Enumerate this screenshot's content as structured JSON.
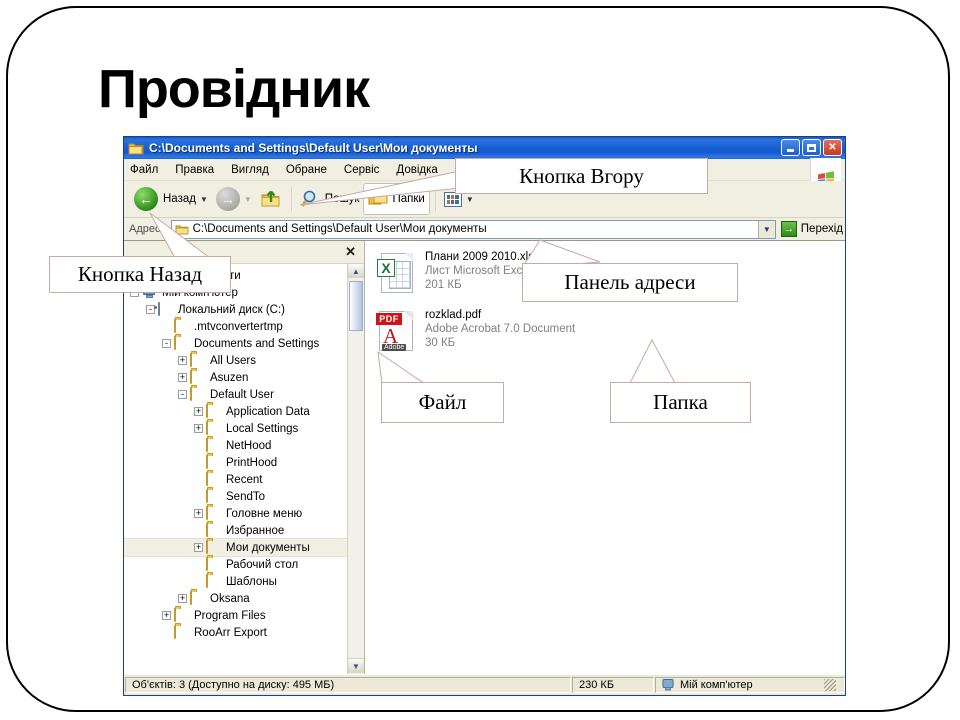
{
  "slide": {
    "title": "Провідник"
  },
  "window": {
    "title": "C:\\Documents and Settings\\Default User\\Мои документы",
    "controls": {
      "minimize": "_",
      "maximize": "□",
      "close": "✕"
    },
    "menu": [
      {
        "label": "Файл",
        "accel": "Ф"
      },
      {
        "label": "Правка",
        "accel": "П"
      },
      {
        "label": "Вигляд",
        "accel": "В"
      },
      {
        "label": "Обране",
        "accel": "О"
      },
      {
        "label": "Сервіс",
        "accel": "е"
      },
      {
        "label": "Довідка",
        "accel": "Д"
      }
    ],
    "toolbar": {
      "back": "Назад",
      "forward": "",
      "up": "",
      "search": "Пошук",
      "folders": "Папки",
      "views": ""
    },
    "address": {
      "label": "Адреса",
      "value": "C:\\Documents and Settings\\Default User\\Мои документы",
      "go": "Перехід"
    },
    "folders_pane": {
      "close": "✕"
    },
    "tree": [
      {
        "label": "Мої документи",
        "indent": 0,
        "expander": "+",
        "icon": "mydocuments-icon",
        "selected": false
      },
      {
        "label": "Мій комп'ютер",
        "indent": 0,
        "expander": "-",
        "icon": "mycomputer-icon",
        "selected": false
      },
      {
        "label": "Локальний диск (C:)",
        "indent": 1,
        "expander": "-",
        "icon": "harddisk-icon",
        "selected": false
      },
      {
        "label": ".mtvconvertertmp",
        "indent": 2,
        "expander": "",
        "icon": "folder-icon",
        "selected": false
      },
      {
        "label": "Documents and Settings",
        "indent": 2,
        "expander": "-",
        "icon": "folder-open-icon",
        "selected": false
      },
      {
        "label": "All Users",
        "indent": 3,
        "expander": "+",
        "icon": "folder-icon",
        "selected": false
      },
      {
        "label": "Asuzen",
        "indent": 3,
        "expander": "+",
        "icon": "folder-icon",
        "selected": false
      },
      {
        "label": "Default User",
        "indent": 3,
        "expander": "-",
        "icon": "folder-open-icon",
        "selected": false
      },
      {
        "label": "Application Data",
        "indent": 4,
        "expander": "+",
        "icon": "folder-icon",
        "selected": false
      },
      {
        "label": "Local Settings",
        "indent": 4,
        "expander": "+",
        "icon": "folder-icon",
        "selected": false
      },
      {
        "label": "NetHood",
        "indent": 4,
        "expander": "",
        "icon": "folder-icon",
        "selected": false
      },
      {
        "label": "PrintHood",
        "indent": 4,
        "expander": "",
        "icon": "folder-icon",
        "selected": false
      },
      {
        "label": "Recent",
        "indent": 4,
        "expander": "",
        "icon": "folder-icon",
        "selected": false
      },
      {
        "label": "SendTo",
        "indent": 4,
        "expander": "",
        "icon": "folder-icon",
        "selected": false
      },
      {
        "label": "Головне меню",
        "indent": 4,
        "expander": "+",
        "icon": "folder-icon",
        "selected": false
      },
      {
        "label": "Избранное",
        "indent": 4,
        "expander": "",
        "icon": "folder-icon",
        "selected": false
      },
      {
        "label": "Мои документы",
        "indent": 4,
        "expander": "+",
        "icon": "folder-open-icon",
        "selected": true
      },
      {
        "label": "Рабочий стол",
        "indent": 4,
        "expander": "",
        "icon": "folder-icon",
        "selected": false
      },
      {
        "label": "Шаблоны",
        "indent": 4,
        "expander": "",
        "icon": "folder-icon",
        "selected": false
      },
      {
        "label": "Oksana",
        "indent": 3,
        "expander": "+",
        "icon": "folder-icon",
        "selected": false
      },
      {
        "label": "Program Files",
        "indent": 2,
        "expander": "+",
        "icon": "folder-icon",
        "selected": false
      },
      {
        "label": "RooArr Export",
        "indent": 2,
        "expander": "",
        "icon": "folder-icon",
        "selected": false
      }
    ],
    "files": [
      {
        "name": "Плани 2009 2010.xls",
        "type": "Лист Microsoft Excel",
        "size": "201 КБ",
        "icon": "excel-file-icon",
        "badge": "X"
      },
      {
        "name": "rozklad.pdf",
        "type": "Adobe Acrobat 7.0 Document",
        "size": "30 КБ",
        "icon": "pdf-file-icon",
        "badge": "PDF",
        "brand": "Adobe"
      }
    ],
    "statusbar": {
      "objects": "Об'єктів: 3 (Доступно на диску: 495 МБ)",
      "size": "230 КБ",
      "location": "Мій комп'ютер"
    }
  },
  "callouts": [
    {
      "id": "up-button",
      "text": "Кнопка Вгору"
    },
    {
      "id": "back-button",
      "text": "Кнопка Назад"
    },
    {
      "id": "address-panel",
      "text": "Панель адреси"
    },
    {
      "id": "file",
      "text": "Файл"
    },
    {
      "id": "folder",
      "text": "Папка"
    }
  ],
  "colors": {
    "titlebar": "#1658cc",
    "chrome": "#ece9d8",
    "accent_green": "#2f8a16",
    "callout_border": "#c9a9a4"
  }
}
